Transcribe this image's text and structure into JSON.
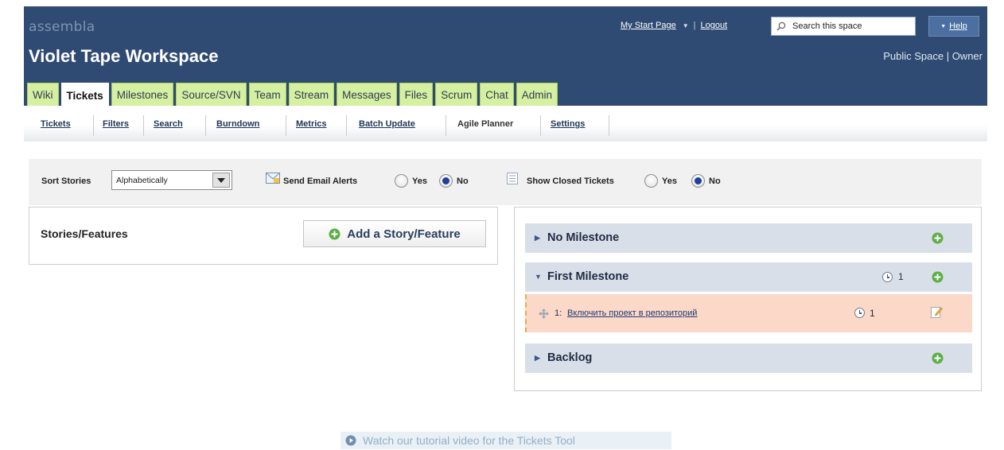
{
  "header": {
    "brand": "assembla",
    "workspace_title": "Violet Tape Workspace",
    "my_start_page": "My Start Page",
    "logout": "Logout",
    "search_placeholder": "Search this space",
    "help": "Help",
    "space_info": "Public Space | Owner",
    "colors": {
      "header_bg": "#2f4b73",
      "tab_bg": "#d5f0a0",
      "help_bg": "#4b6fa0"
    }
  },
  "tabs": [
    {
      "label": "Wiki"
    },
    {
      "label": "Tickets",
      "active": true
    },
    {
      "label": "Milestones"
    },
    {
      "label": "Source/SVN"
    },
    {
      "label": "Team"
    },
    {
      "label": "Stream"
    },
    {
      "label": "Messages"
    },
    {
      "label": "Files"
    },
    {
      "label": "Scrum"
    },
    {
      "label": "Chat"
    },
    {
      "label": "Admin"
    }
  ],
  "subnav": {
    "items": [
      "Tickets",
      "Filters",
      "Search",
      "Burndown",
      "Metrics",
      "Batch Update",
      "Agile Planner",
      "Settings"
    ],
    "active": "Agile Planner"
  },
  "filters": {
    "sort_label": "Sort Stories",
    "sort_value": "Alphabetically",
    "email_label": "Send Email Alerts",
    "email_yes": "Yes",
    "email_no": "No",
    "email_selected": "No",
    "closed_label": "Show Closed Tickets",
    "closed_yes": "Yes",
    "closed_no": "No",
    "closed_selected": "No"
  },
  "stories": {
    "title": "Stories/Features",
    "add_button": "Add a Story/Feature"
  },
  "milestones": {
    "no_milestone": {
      "name": "No Milestone"
    },
    "first": {
      "name": "First Milestone",
      "count": "1",
      "ticket": {
        "number": "1:",
        "title": "Включить проект в репозиторий",
        "count": "1"
      }
    },
    "backlog": {
      "name": "Backlog"
    }
  },
  "tutorial": {
    "text": "Watch our tutorial video for the Tickets Tool"
  },
  "icons": [
    "search-icon",
    "help-caret-icon",
    "email-icon",
    "list-icon",
    "add-icon",
    "clock-icon",
    "move-icon",
    "edit-icon",
    "play-icon"
  ]
}
